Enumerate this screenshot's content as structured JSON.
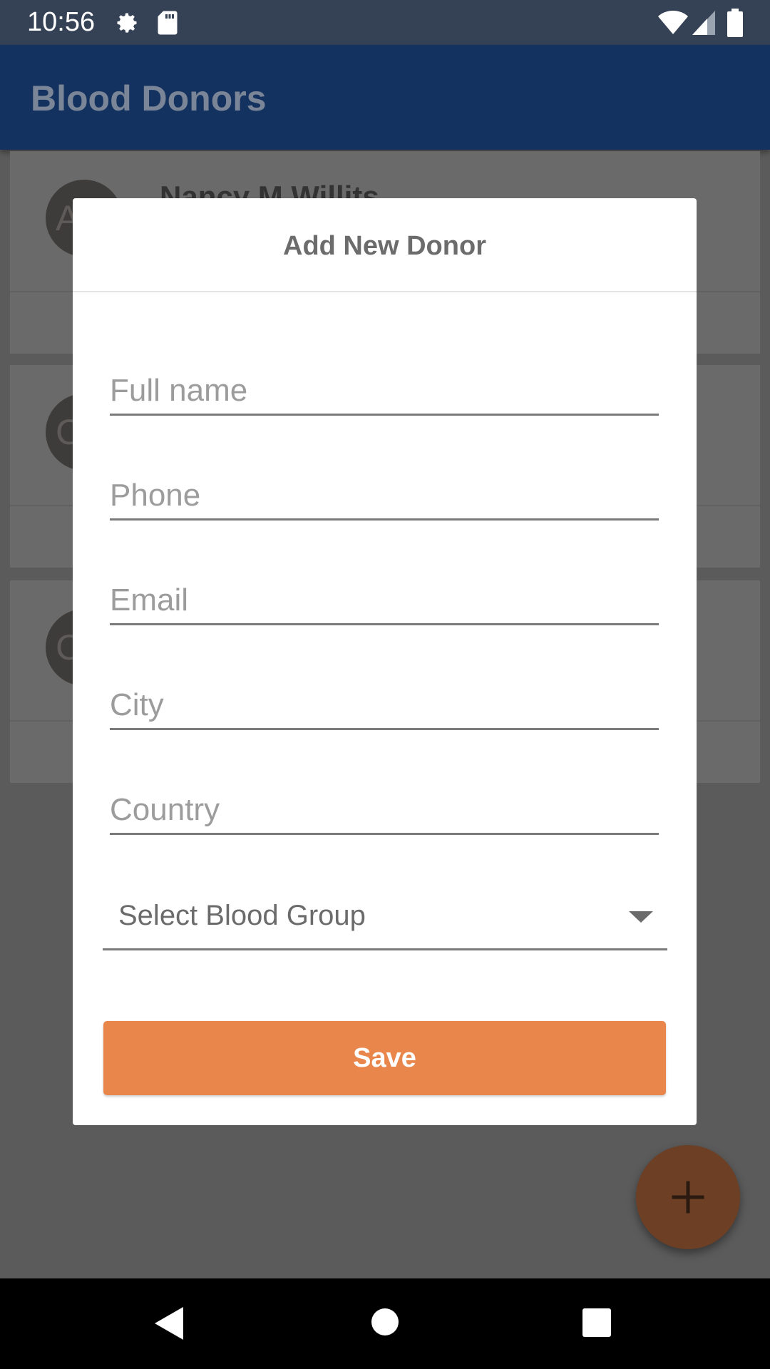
{
  "status_bar": {
    "time": "10:56",
    "icons": [
      "settings-icon",
      "sd-card-icon",
      "wifi-icon",
      "cell-signal-icon",
      "battery-icon"
    ]
  },
  "app_bar": {
    "title": "Blood Donors"
  },
  "background_list": {
    "items": [
      {
        "avatar_letter": "A",
        "name": "Nancy M Willits"
      },
      {
        "avatar_letter": "C",
        "name": ""
      },
      {
        "avatar_letter": "C",
        "name": ""
      }
    ]
  },
  "dialog": {
    "title": "Add New Donor",
    "fields": {
      "full_name_placeholder": "Full name",
      "phone_placeholder": "Phone",
      "email_placeholder": "Email",
      "city_placeholder": "City",
      "country_placeholder": "Country"
    },
    "blood_group": {
      "selected": "Select Blood Group"
    },
    "save_label": "Save"
  },
  "fab": {
    "icon": "plus-icon"
  },
  "nav_bar": {
    "icons": [
      "back-icon",
      "home-icon",
      "recents-icon"
    ]
  },
  "colors": {
    "accent": "#e8864c",
    "app_bar": "#14325f",
    "status_bar": "#354256"
  }
}
